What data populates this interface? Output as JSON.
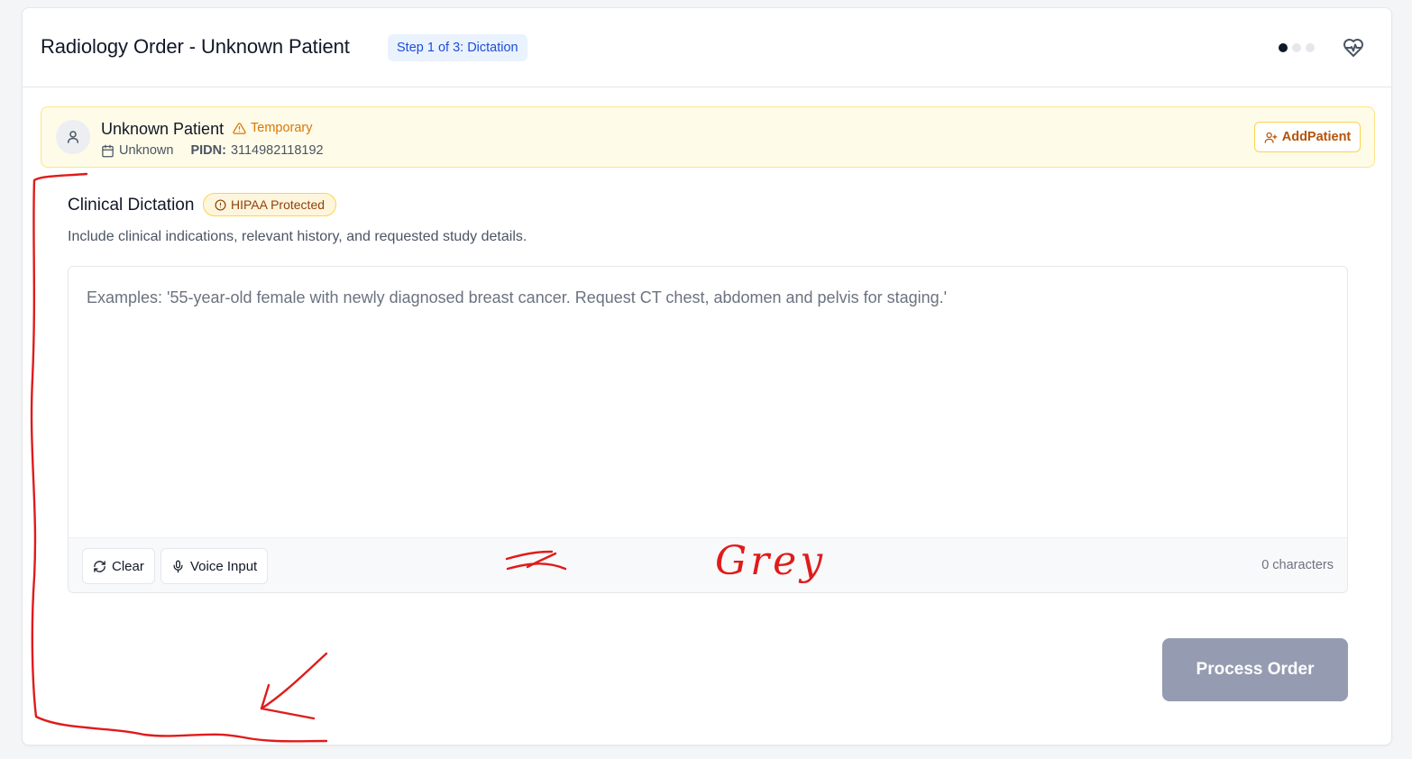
{
  "header": {
    "title": "Radiology Order - Unknown Patient",
    "step_badge": "Step 1 of 3: Dictation",
    "progress": {
      "current_step": 1,
      "total_steps": 3
    },
    "icons": {
      "health": "heart-pulse-icon"
    }
  },
  "patient": {
    "name": "Unknown Patient",
    "status_badge": "Temporary",
    "dob": "Unknown",
    "pidn_label": "PIDN:",
    "pidn_value": "3114982118192",
    "add_button_label": "AddPatient",
    "icons": {
      "avatar": "user-icon",
      "status": "warning-triangle-icon",
      "dob": "calendar-icon",
      "add": "user-plus-icon"
    }
  },
  "dictation": {
    "title": "Clinical Dictation",
    "badge": "HIPAA Protected",
    "description": "Include clinical indications, relevant history, and requested study details.",
    "value": "",
    "placeholder": "Examples: '55-year-old female with newly diagnosed breast cancer. Request CT chest, abdomen and pelvis for staging.'",
    "clear_label": "Clear",
    "voice_label": "Voice Input",
    "char_count": "0 characters",
    "icons": {
      "badge": "alert-circle-icon",
      "clear": "refresh-icon",
      "voice": "microphone-icon"
    }
  },
  "actions": {
    "process_label": "Process Order"
  },
  "annotation_text": "Grey",
  "colors": {
    "step_badge_bg": "#eaf2fe",
    "step_badge_text": "#1d4ed8",
    "patient_banner_bg": "#fefbe8",
    "warning": "#d97706",
    "process_button_disabled": "#959cb1",
    "annotation_ink": "#e01b1b"
  }
}
